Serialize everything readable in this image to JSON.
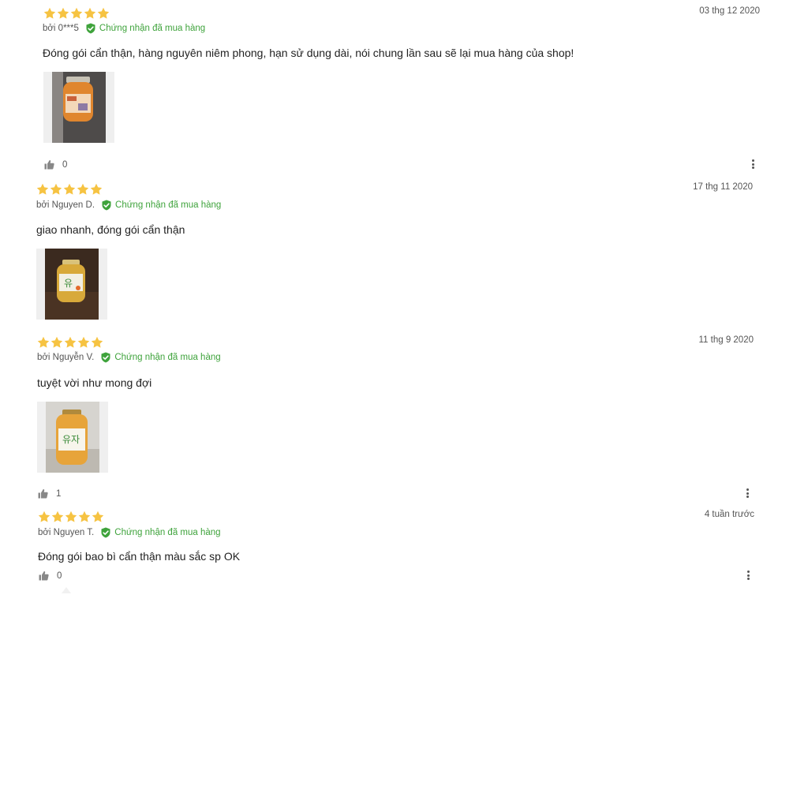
{
  "colors": {
    "star": "#f6c342",
    "verified": "#3fa33c",
    "text": "#222222",
    "muted": "#555555"
  },
  "icons": {
    "star": "star-icon",
    "verified": "check-shield-icon",
    "like": "thumbs-up-icon",
    "more": "more-vertical-icon"
  },
  "reviews": [
    {
      "rating": 5,
      "date": "03 thg 12 2020",
      "author": "bởi 0***5",
      "verified": "Chứng nhận đã mua hàng",
      "text": "Đóng gói cẩn thận, hàng nguyên niêm phong, hạn sử dụng dài, nói chung lần sau sẽ lại mua hàng của shop!",
      "image": "photo-of-honey-citron-tea-jar",
      "likes": "0"
    },
    {
      "rating": 5,
      "date": "17 thg 11 2020",
      "author": "bởi Nguyen D.",
      "verified": "Chứng nhận đã mua hàng",
      "text": "giao nhanh, đóng gói cẩn thận",
      "image": "photo-of-honey-citron-tea-jar"
    },
    {
      "rating": 5,
      "date": "11 thg 9 2020",
      "author": "bởi Nguyễn V.",
      "verified": "Chứng nhận đã mua hàng",
      "text": "tuyệt vời như mong đợi",
      "image": "photo-of-honey-citron-tea-jar",
      "likes": "1"
    },
    {
      "rating": 5,
      "date": "4 tuần trước",
      "author": "bởi Nguyen T.",
      "verified": "Chứng nhận đã mua hàng",
      "text": "Đóng gói bao bì cẩn thận màu sắc sp OK",
      "likes": "0"
    }
  ]
}
